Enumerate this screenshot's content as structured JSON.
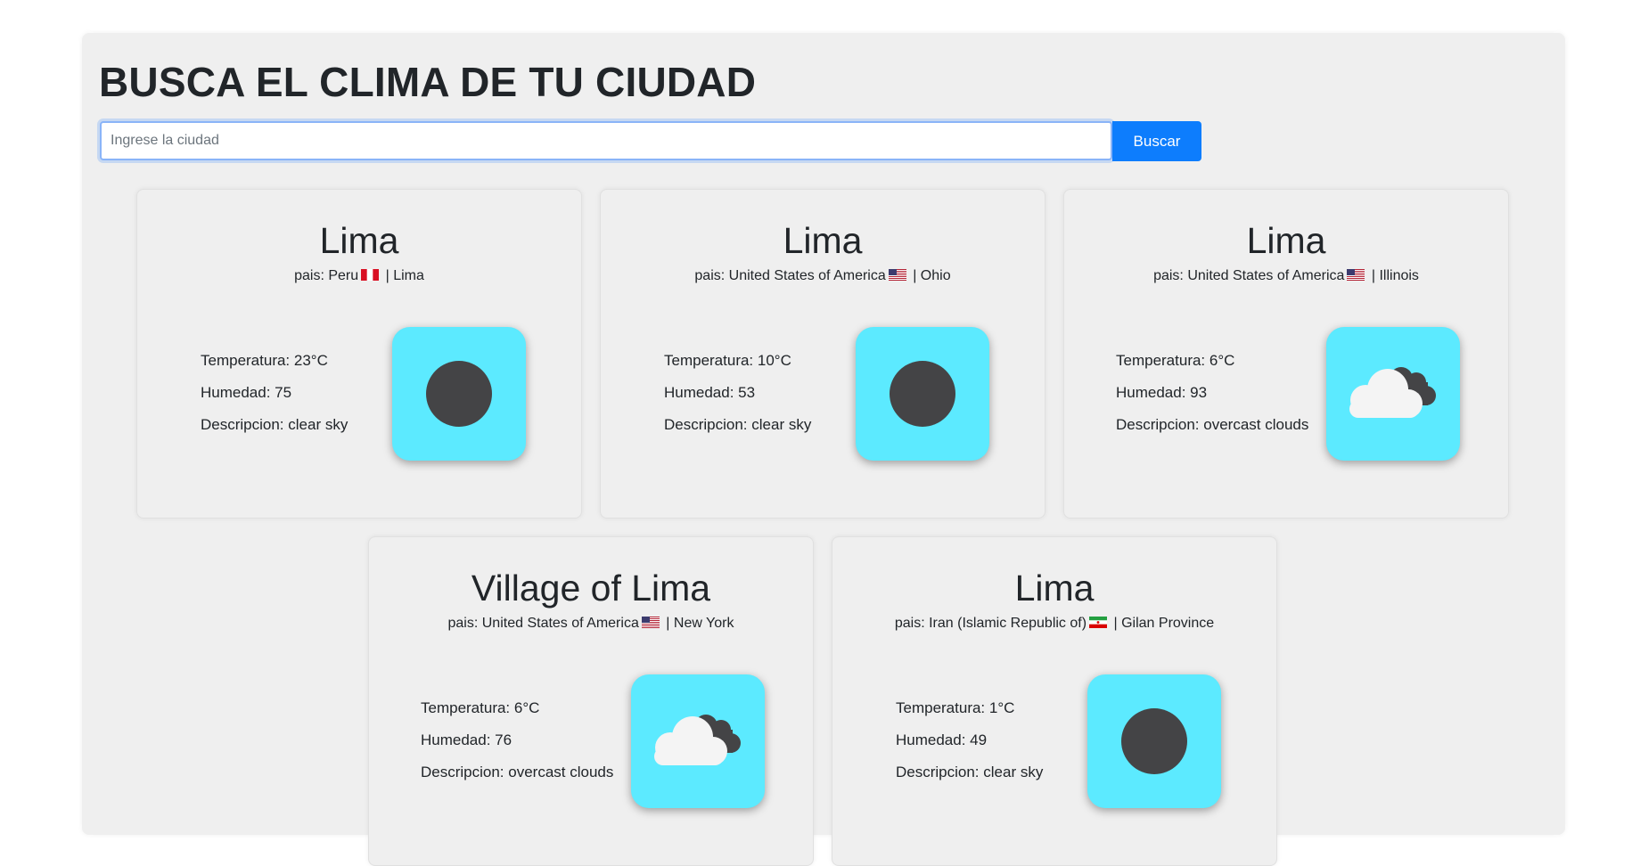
{
  "header": {
    "title": "BUSCA EL CLIMA DE TU CIUDAD"
  },
  "search": {
    "placeholder": "Ingrese la ciudad",
    "value": "",
    "button_label": "Buscar"
  },
  "colors": {
    "panel_background": "#efefef",
    "button_accent": "#0d7dfd",
    "weather_icon_background": "#5ceaff"
  },
  "labels": {
    "country_prefix": "pais: ",
    "separator": " | ",
    "temperature": "Temperatura: ",
    "humidity": "Humedad: ",
    "description": "Descripcion: "
  },
  "cards": [
    {
      "city": "Lima",
      "country": "Peru",
      "flag": "peru-flag-icon",
      "region": "Lima",
      "temperature": "23°C",
      "humidity": "75",
      "description": "clear sky",
      "icon": "clear-sky-icon"
    },
    {
      "city": "Lima",
      "country": "United States of America",
      "flag": "usa-flag-icon",
      "region": "Ohio",
      "temperature": "10°C",
      "humidity": "53",
      "description": "clear sky",
      "icon": "clear-sky-icon"
    },
    {
      "city": "Lima",
      "country": "United States of America",
      "flag": "usa-flag-icon",
      "region": "Illinois",
      "temperature": "6°C",
      "humidity": "93",
      "description": "overcast clouds",
      "icon": "overcast-clouds-icon"
    },
    {
      "city": "Village of Lima",
      "country": "United States of America",
      "flag": "usa-flag-icon",
      "region": "New York",
      "temperature": "6°C",
      "humidity": "76",
      "description": "overcast clouds",
      "icon": "overcast-clouds-icon"
    },
    {
      "city": "Lima",
      "country": "Iran (Islamic Republic of)",
      "flag": "iran-flag-icon",
      "region": "Gilan Province",
      "temperature": "1°C",
      "humidity": "49",
      "description": "clear sky",
      "icon": "clear-sky-icon"
    }
  ]
}
